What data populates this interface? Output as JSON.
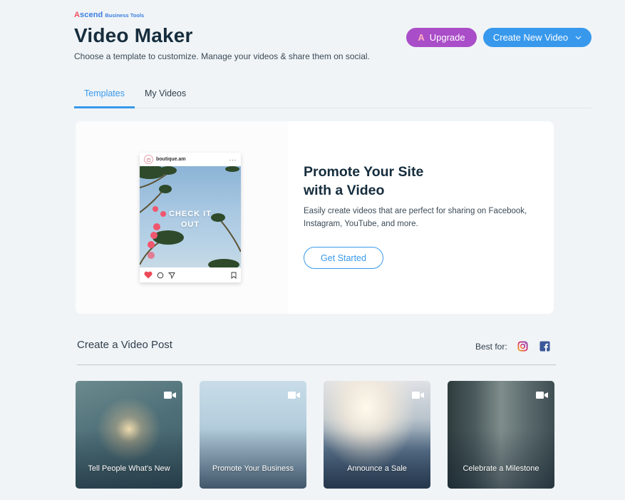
{
  "brand": {
    "name_first_letter": "A",
    "name_rest": "scend",
    "sub": "Business Tools"
  },
  "header": {
    "title": "Video Maker",
    "subtitle": "Choose a template to customize. Manage your videos & share them on social.",
    "upgrade_icon": "A",
    "upgrade_label": "Upgrade",
    "create_label": "Create New Video",
    "create_chevron": "⌄"
  },
  "tabs": [
    {
      "label": "Templates",
      "active": true
    },
    {
      "label": "My Videos",
      "active": false
    }
  ],
  "banner": {
    "post": {
      "username": "boutique.am",
      "more": "···",
      "overlay_line1": "CHECK IT",
      "overlay_line2": "OUT"
    },
    "title_line1": "Promote Your Site",
    "title_line2": "with a Video",
    "description": "Easily create videos that are perfect for sharing on Facebook, Instagram, YouTube, and more.",
    "cta_label": "Get Started"
  },
  "section": {
    "title": "Create a Video Post",
    "best_for_label": "Best for:",
    "best_for_icons": [
      "instagram-icon",
      "facebook-icon"
    ]
  },
  "cards": [
    {
      "label": "Tell People What's New",
      "icon": "video-camera-icon"
    },
    {
      "label": "Promote Your Business",
      "icon": "video-camera-icon"
    },
    {
      "label": "Announce a Sale",
      "icon": "video-camera-icon"
    },
    {
      "label": "Celebrate a Milestone",
      "icon": "video-camera-icon"
    }
  ],
  "colors": {
    "background": "#f0f4f7",
    "primary": "#3899ec",
    "upgrade": "#aa4dc8",
    "brand_accent": "#f0515f",
    "title": "#162d3d"
  }
}
